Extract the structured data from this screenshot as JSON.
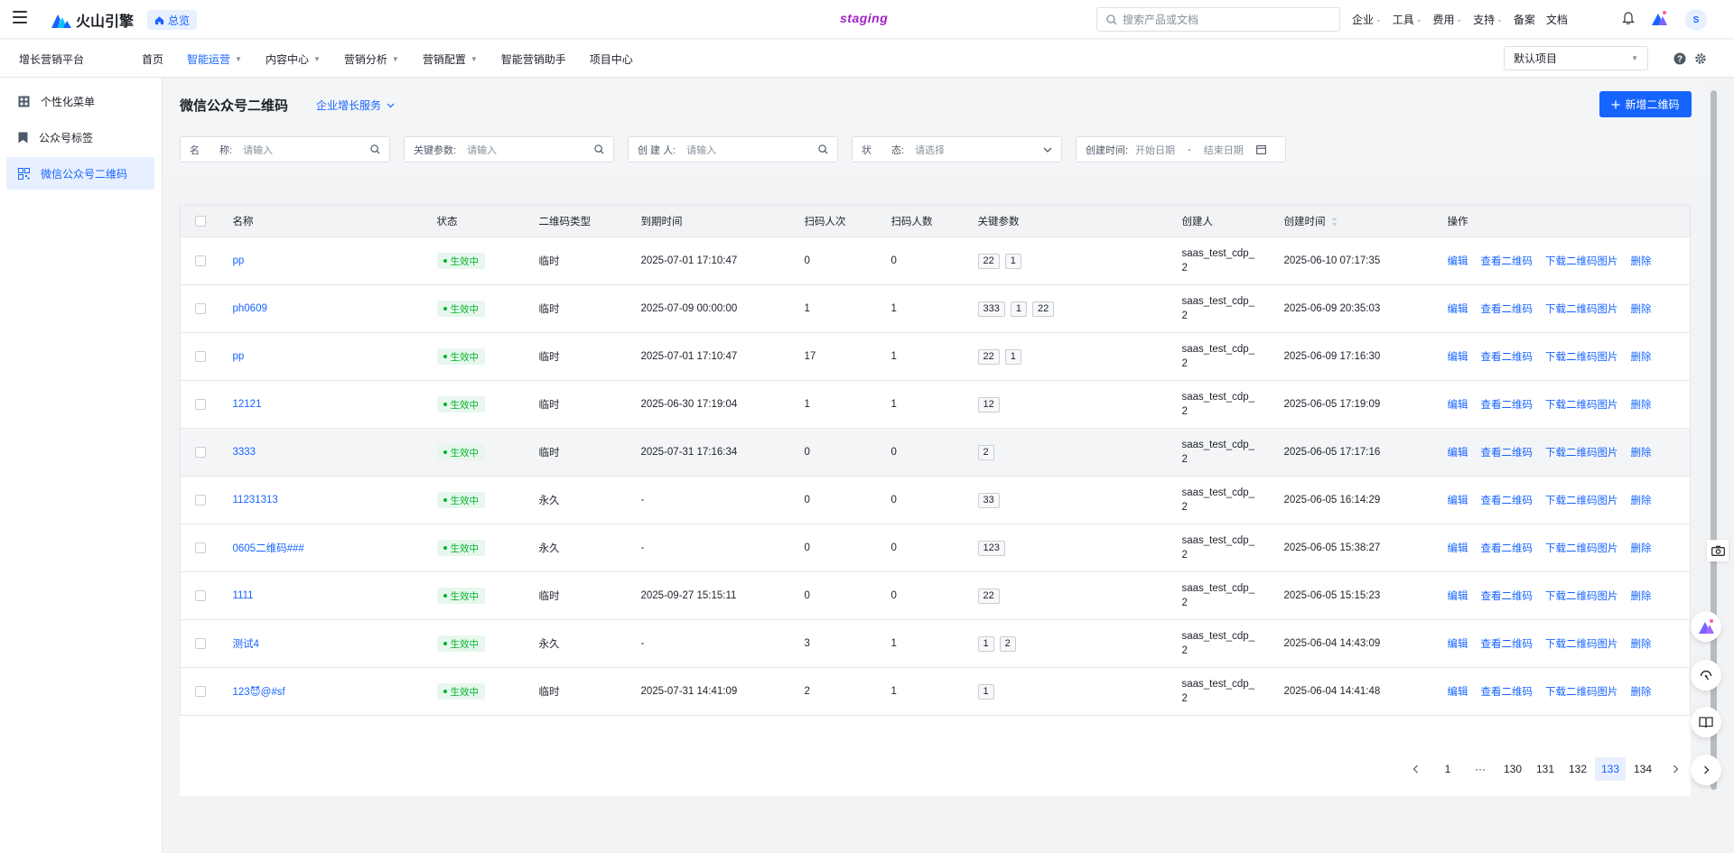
{
  "topbar": {
    "brand": "火山引擎",
    "overview": "总览",
    "env": "staging",
    "search_placeholder": "搜索产品或文档",
    "nav": [
      "企业",
      "工具",
      "费用",
      "支持",
      "备案",
      "文档"
    ],
    "avatar": "S"
  },
  "subnav": {
    "platform": "增长营销平台",
    "items": [
      {
        "label": "首页",
        "dropdown": false
      },
      {
        "label": "智能运营",
        "dropdown": true,
        "active": true
      },
      {
        "label": "内容中心",
        "dropdown": true
      },
      {
        "label": "营销分析",
        "dropdown": true
      },
      {
        "label": "营销配置",
        "dropdown": true
      },
      {
        "label": "智能营销助手",
        "dropdown": false
      },
      {
        "label": "项目中心",
        "dropdown": false
      }
    ],
    "project": "默认项目"
  },
  "sidebar": {
    "items": [
      {
        "label": "个性化菜单",
        "icon": "menu-grid-icon"
      },
      {
        "label": "公众号标签",
        "icon": "bookmark-icon"
      },
      {
        "label": "微信公众号二维码",
        "icon": "qrcode-icon",
        "active": true
      }
    ]
  },
  "page": {
    "title": "微信公众号二维码",
    "service": "企业增长服务",
    "new_button": "新增二维码"
  },
  "filters": {
    "name_label": "名　　称:",
    "name_ph": "请输入",
    "kw_label": "关键参数:",
    "kw_ph": "请输入",
    "creator_label": "创 建 人:",
    "creator_ph": "请输入",
    "status_label": "状　　态:",
    "status_ph": "请选择",
    "time_label": "创建时间:",
    "start_ph": "开始日期",
    "sep": "-",
    "end_ph": "结束日期"
  },
  "table": {
    "columns": [
      "名称",
      "状态",
      "二维码类型",
      "到期时间",
      "扫码人次",
      "扫码人数",
      "关键参数",
      "创建人",
      "创建时间",
      "操作"
    ],
    "actions": [
      "编辑",
      "查看二维码",
      "下载二维码图片",
      "删除"
    ],
    "rows": [
      {
        "name": "pp",
        "status": "生效中",
        "type": "临时",
        "expire": "2025-07-01 17:10:47",
        "scans": "0",
        "users": "0",
        "params": [
          "22",
          "1"
        ],
        "creator": "saas_test_cdp_2",
        "created": "2025-06-10 07:17:35"
      },
      {
        "name": "ph0609",
        "status": "生效中",
        "type": "临时",
        "expire": "2025-07-09 00:00:00",
        "scans": "1",
        "users": "1",
        "params": [
          "333",
          "1",
          "22"
        ],
        "creator": "saas_test_cdp_2",
        "created": "2025-06-09 20:35:03"
      },
      {
        "name": "pp",
        "status": "生效中",
        "type": "临时",
        "expire": "2025-07-01 17:10:47",
        "scans": "17",
        "users": "1",
        "params": [
          "22",
          "1"
        ],
        "creator": "saas_test_cdp_2",
        "created": "2025-06-09 17:16:30"
      },
      {
        "name": "12121",
        "status": "生效中",
        "type": "临时",
        "expire": "2025-06-30 17:19:04",
        "scans": "1",
        "users": "1",
        "params": [
          "12"
        ],
        "creator": "saas_test_cdp_2",
        "created": "2025-06-05 17:19:09"
      },
      {
        "name": "3333",
        "status": "生效中",
        "type": "临时",
        "expire": "2025-07-31 17:16:34",
        "scans": "0",
        "users": "0",
        "params": [
          "2"
        ],
        "creator": "saas_test_cdp_2",
        "created": "2025-06-05 17:17:16"
      },
      {
        "name": "11231313",
        "status": "生效中",
        "type": "永久",
        "expire": "-",
        "scans": "0",
        "users": "0",
        "params": [
          "33"
        ],
        "creator": "saas_test_cdp_2",
        "created": "2025-06-05 16:14:29"
      },
      {
        "name": "0605二维码###",
        "status": "生效中",
        "type": "永久",
        "expire": "-",
        "scans": "0",
        "users": "0",
        "params": [
          "123"
        ],
        "creator": "saas_test_cdp_2",
        "created": "2025-06-05 15:38:27"
      },
      {
        "name": "1111",
        "status": "生效中",
        "type": "临时",
        "expire": "2025-09-27 15:15:11",
        "scans": "0",
        "users": "0",
        "params": [
          "22"
        ],
        "creator": "saas_test_cdp_2",
        "created": "2025-06-05 15:15:23"
      },
      {
        "name": "测试4",
        "status": "生效中",
        "type": "永久",
        "expire": "-",
        "scans": "3",
        "users": "1",
        "params": [
          "1",
          "2"
        ],
        "creator": "saas_test_cdp_2",
        "created": "2025-06-04 14:43:09"
      },
      {
        "name": "123😈@#sf",
        "status": "生效中",
        "type": "临时",
        "expire": "2025-07-31 14:41:09",
        "scans": "2",
        "users": "1",
        "params": [
          "1"
        ],
        "creator": "saas_test_cdp_2",
        "created": "2025-06-04 14:41:48"
      }
    ]
  },
  "pagination": {
    "pages": [
      "1",
      "···",
      "130",
      "131",
      "132",
      "133",
      "134"
    ],
    "current": "133"
  }
}
